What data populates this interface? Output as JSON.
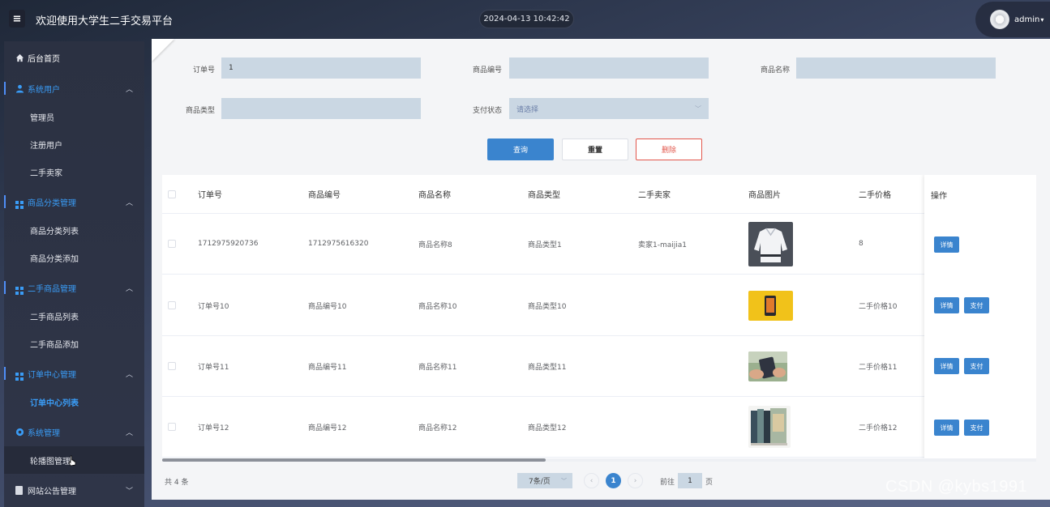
{
  "header": {
    "menu_icon": "hamburger-icon",
    "title": "欢迎使用大学生二手交易平台",
    "datetime": "2024-04-13 10:42:42",
    "user_name": "admin"
  },
  "sidebar": {
    "home": "后台首页",
    "groups": [
      {
        "label": "系统用户",
        "icon": "user-icon",
        "items": [
          "管理员",
          "注册用户",
          "二手卖家"
        ]
      },
      {
        "label": "商品分类管理",
        "icon": "grid-icon",
        "items": [
          "商品分类列表",
          "商品分类添加"
        ]
      },
      {
        "label": "二手商品管理",
        "icon": "grid-icon",
        "items": [
          "二手商品列表",
          "二手商品添加"
        ]
      },
      {
        "label": "订单中心管理",
        "icon": "grid-icon",
        "items": [
          "订单中心列表"
        ]
      },
      {
        "label": "系统管理",
        "icon": "gear-icon",
        "items": [
          "轮播图管理"
        ]
      },
      {
        "label": "网站公告管理",
        "icon": "document-icon",
        "items": []
      }
    ],
    "active_item": "订单中心列表"
  },
  "search": {
    "order_no_label": "订单号",
    "order_no_value": "1",
    "goods_no_label": "商品编号",
    "goods_no_value": "",
    "goods_name_label": "商品名称",
    "goods_name_value": "",
    "goods_type_label": "商品类型",
    "goods_type_value": "",
    "pay_status_label": "支付状态",
    "pay_status_placeholder": "请选择",
    "query_btn": "查询",
    "reset_btn": "重置",
    "delete_btn": "删除"
  },
  "table": {
    "headers": [
      "订单号",
      "商品编号",
      "商品名称",
      "商品类型",
      "二手卖家",
      "商品图片",
      "二手价格",
      "操作"
    ],
    "detail_btn": "详情",
    "pay_btn": "支付",
    "rows": [
      {
        "order_no": "1712975920736",
        "goods_no": "1712975616320",
        "goods_name": "商品名称8",
        "goods_type": "商品类型1",
        "seller": "卖家1-maijia1",
        "image": "hoodie-photo",
        "price": "8",
        "has_pay": false
      },
      {
        "order_no": "订单号10",
        "goods_no": "商品编号10",
        "goods_name": "商品名称10",
        "goods_type": "商品类型10",
        "seller": "",
        "image": "phone-yellow-photo",
        "price": "二手价格10",
        "has_pay": true
      },
      {
        "order_no": "订单号11",
        "goods_no": "商品编号11",
        "goods_name": "商品名称11",
        "goods_type": "商品类型11",
        "seller": "",
        "image": "phone-hands-photo",
        "price": "二手价格11",
        "has_pay": true
      },
      {
        "order_no": "订单号12",
        "goods_no": "商品编号12",
        "goods_name": "商品名称12",
        "goods_type": "商品类型12",
        "seller": "",
        "image": "books-photo",
        "price": "二手价格12",
        "has_pay": true
      }
    ]
  },
  "pagination": {
    "total": "共 4 条",
    "page_size": "7条/页",
    "current_page": "1",
    "goto_prefix": "前往",
    "goto_value": "1",
    "goto_suffix": "页"
  },
  "watermark": "CSDN @kybs1991",
  "colors": {
    "accent": "#3a84ce",
    "sidebar_active": "#3a9cf6",
    "danger": "#e2574c",
    "input_bg": "#cad7e3"
  }
}
